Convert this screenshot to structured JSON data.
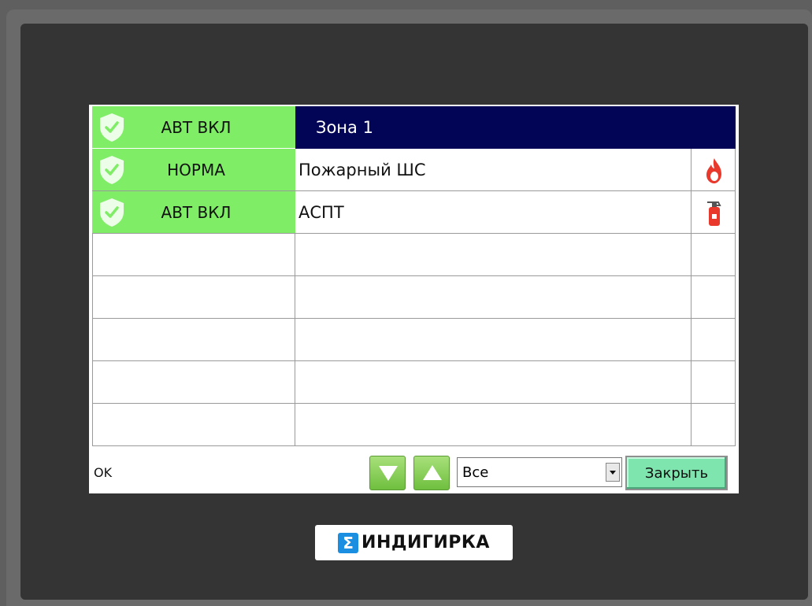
{
  "zone": {
    "title": "Зона 1",
    "status": "АВТ ВКЛ",
    "status_icon": "shield-check-icon"
  },
  "rows": [
    {
      "status": "НОРМА",
      "name": "Пожарный ШС",
      "status_icon": "shield-check-icon",
      "type_icon": "flame-icon"
    },
    {
      "status": "АВТ ВКЛ",
      "name": "АСПТ",
      "status_icon": "shield-check-icon",
      "type_icon": "fire-extinguisher-icon"
    },
    {
      "status": "",
      "name": ""
    },
    {
      "status": "",
      "name": ""
    },
    {
      "status": "",
      "name": ""
    },
    {
      "status": "",
      "name": ""
    },
    {
      "status": "",
      "name": ""
    }
  ],
  "footer": {
    "status_text": "OK",
    "filter_value": "Все",
    "close_label": "Закрыть",
    "down_icon": "arrow-down-icon",
    "up_icon": "arrow-up-icon"
  },
  "brand": {
    "mark": "Σ",
    "name": "ИНДИГИРКА"
  },
  "colors": {
    "active_status": "#7fee66",
    "header": "#020555",
    "icon_red": "#e8392c",
    "close_button": "#7fe5ae",
    "arrow_button": "#8ed35c",
    "brand_blue": "#1a8ee0"
  }
}
